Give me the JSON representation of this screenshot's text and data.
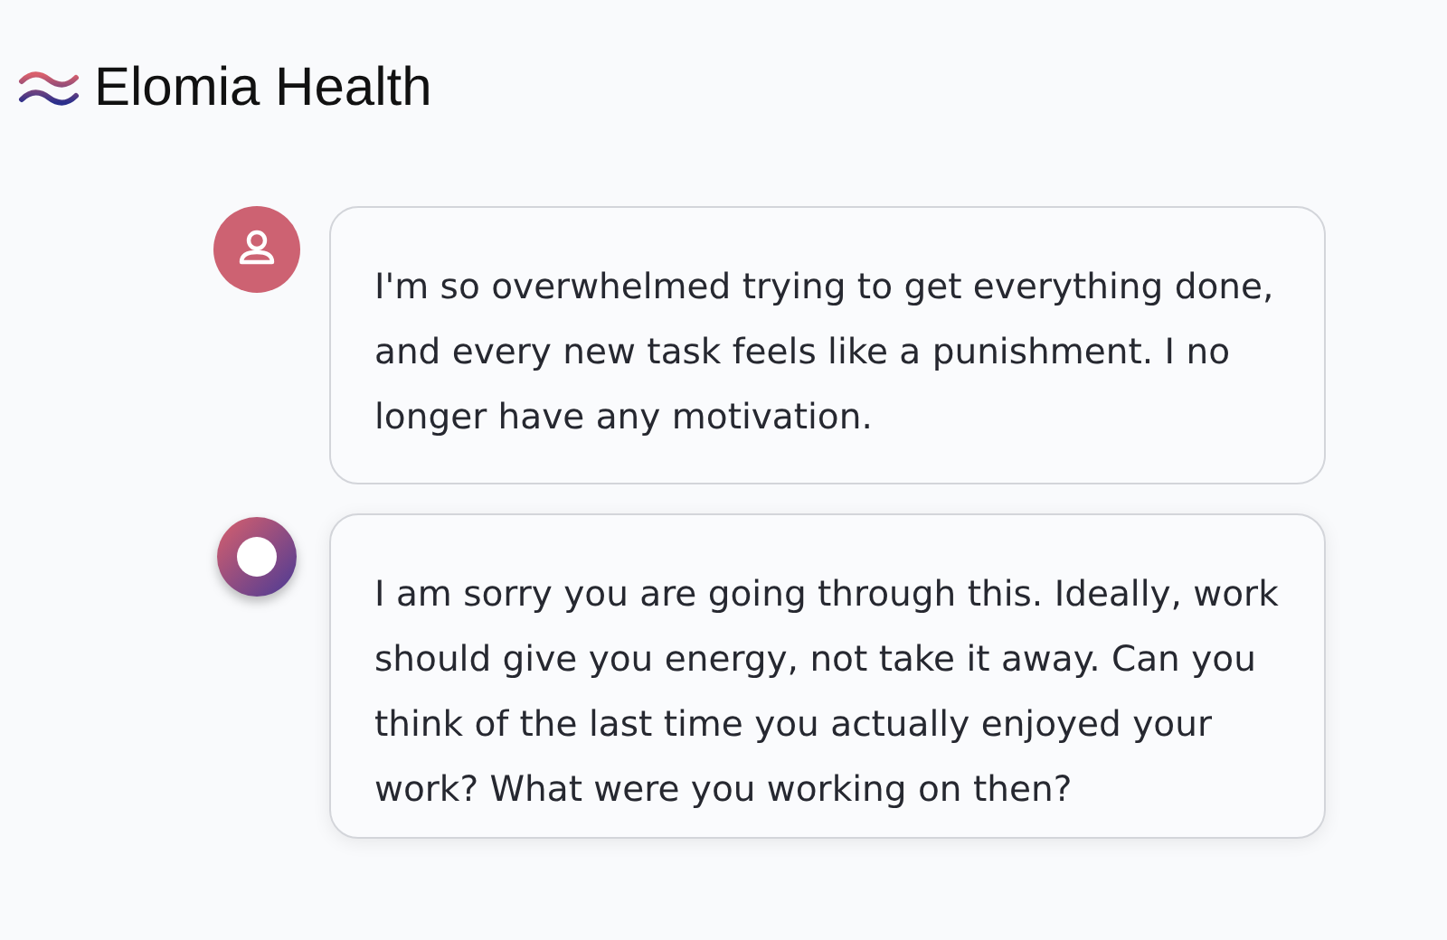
{
  "header": {
    "brand": "Elomia Health"
  },
  "messages": [
    {
      "kind": "user",
      "text": "I'm so overwhelmed trying to get everything done, and every new task feels like a punishment. I no longer have any motivation."
    },
    {
      "kind": "assistant",
      "text": "I am sorry you are going through this. Ideally, work should give you energy, not take it away. Can you think of the last time you actually enjoyed your work? What were you working on then?"
    }
  ]
}
